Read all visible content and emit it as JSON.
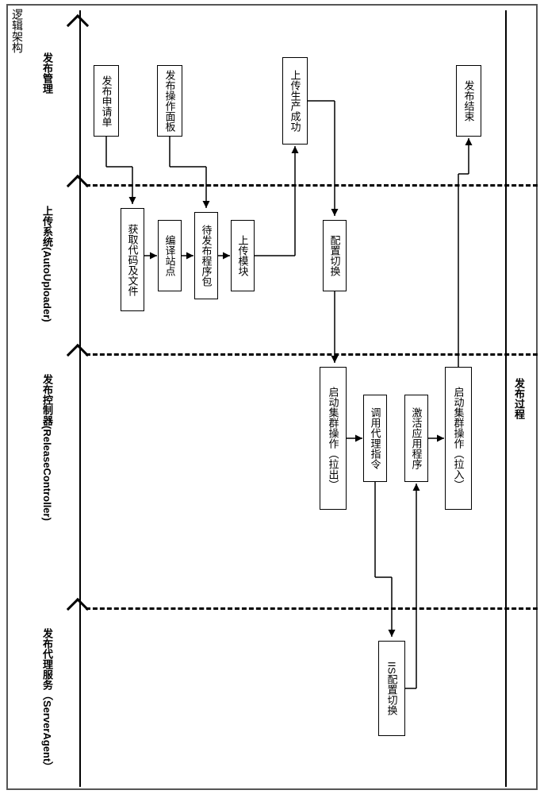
{
  "title": "逻辑架构",
  "lanes": {
    "publish_mgmt": "发布管理",
    "upload_system": "上传系统(AutoUploader)",
    "publish_controller": "发布控制器(ReleaseController)",
    "publish_agent": "发布代理服务（ServerAgent）"
  },
  "side_label": "发布过程",
  "boxes": {
    "req_form": "发布申请单",
    "op_panel": "发布操作面板",
    "upload_success": "上传生产成功",
    "publish_end": "发布结束",
    "get_code": "获取代码及文件",
    "compile_site": "编译站点",
    "pending_pkg": "待发布程序包",
    "upload_module": "上传模块",
    "config_switch": "配置切换",
    "cluster_pull_out": "启动集群操作（拉出）",
    "call_agent_cmd": "调用代理指令",
    "activate_app": "激活应用程序",
    "cluster_pull_in": "启动集群操作（拉入）",
    "iis_switch": "IIS配置切换"
  }
}
